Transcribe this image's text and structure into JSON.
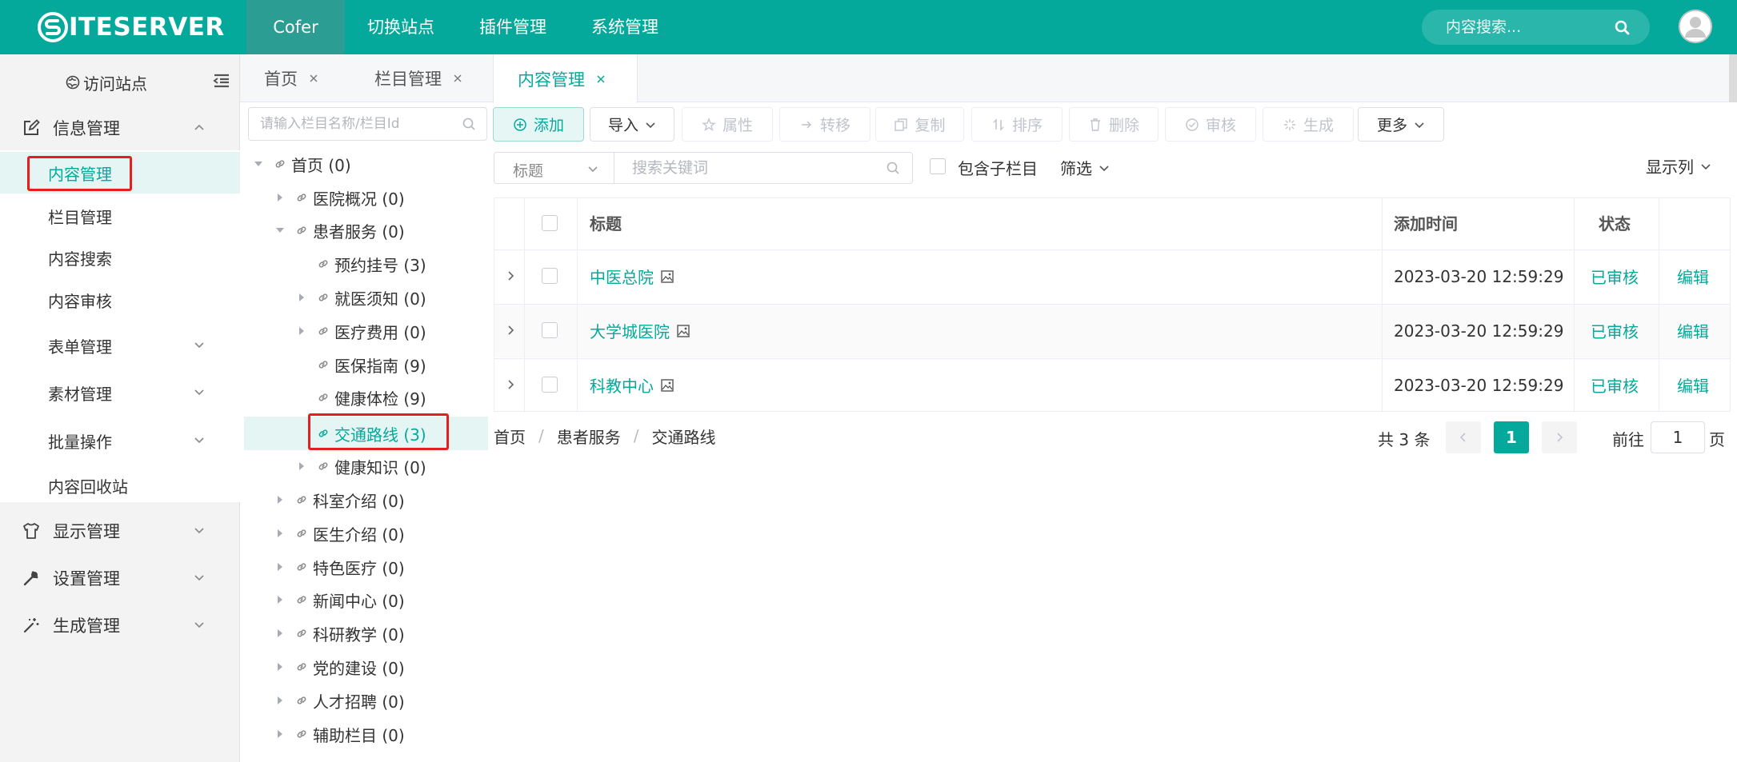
{
  "brand": {
    "logo_text": "ITESERVER"
  },
  "topnav": {
    "items": [
      "Cofer",
      "切换站点",
      "插件管理",
      "系统管理"
    ],
    "search_placeholder": "内容搜索..."
  },
  "sidebar": {
    "visit_label": "访问站点",
    "groups": [
      {
        "label": "信息管理",
        "icon": "edit-icon",
        "expanded": true
      },
      {
        "label": "显示管理",
        "icon": "shirt-icon"
      },
      {
        "label": "设置管理",
        "icon": "wrench-icon"
      },
      {
        "label": "生成管理",
        "icon": "magic-wand-icon"
      }
    ],
    "sub_items": [
      "内容管理",
      "栏目管理",
      "内容搜索",
      "内容审核",
      "表单管理",
      "素材管理",
      "批量操作",
      "内容回收站"
    ],
    "active_sub": "内容管理"
  },
  "tabs": [
    "首页",
    "栏目管理",
    "内容管理"
  ],
  "tree": {
    "search_placeholder": "请输入栏目名称/栏目Id",
    "nodes": [
      "首页 (0)",
      "医院概况 (0)",
      "患者服务 (0)",
      "预约挂号 (3)",
      "就医须知 (0)",
      "医疗费用 (0)",
      "医保指南 (9)",
      "健康体检 (9)",
      "交通路线 (3)",
      "健康知识 (0)",
      "科室介绍 (0)",
      "医生介绍 (0)",
      "特色医疗 (0)",
      "新闻中心 (0)",
      "科研教学 (0)",
      "党的建设 (0)",
      "人才招聘 (0)",
      "辅助栏目 (0)"
    ],
    "selected": "交通路线 (3)"
  },
  "toolbar": [
    "添加",
    "导入",
    "属性",
    "转移",
    "复制",
    "排序",
    "删除",
    "审核",
    "生成",
    "更多"
  ],
  "filter": {
    "field": "标题",
    "keyword_placeholder": "搜索关键词",
    "include_children": "包含子栏目",
    "filter_label": "筛选",
    "columns_label": "显示列"
  },
  "table": {
    "headers": [
      "标题",
      "添加时间",
      "状态"
    ],
    "rows": [
      {
        "title": "中医总院",
        "time": "2023-03-20 12:59:29",
        "status": "已审核",
        "action": "编辑"
      },
      {
        "title": "大学城医院",
        "time": "2023-03-20 12:59:29",
        "status": "已审核",
        "action": "编辑"
      },
      {
        "title": "科教中心",
        "time": "2023-03-20 12:59:29",
        "status": "已审核",
        "action": "编辑"
      }
    ]
  },
  "breadcrumb": [
    "首页",
    "患者服务",
    "交通路线"
  ],
  "pager": {
    "total": "共 3 条",
    "current": "1",
    "goto_prefix": "前往",
    "goto_value": "1",
    "goto_suffix": "页"
  },
  "colors": {
    "brand": "#05a99b",
    "annotation": "#e51f1f"
  }
}
